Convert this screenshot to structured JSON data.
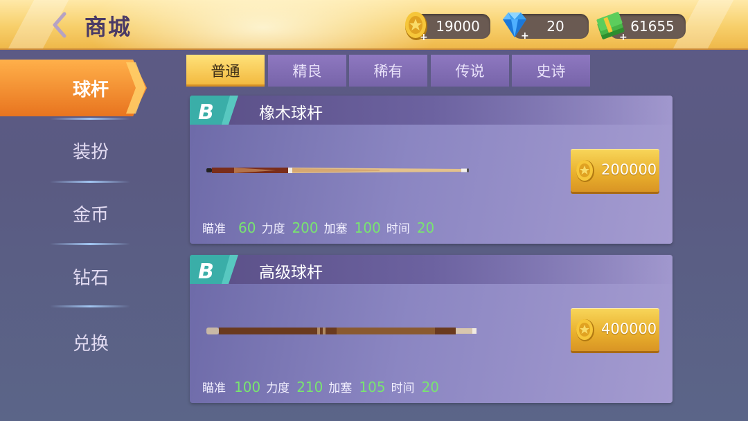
{
  "header": {
    "title": "商城"
  },
  "currencies": {
    "coins": "19000",
    "diamonds": "20",
    "cash": "61655"
  },
  "sidebar": {
    "items": [
      {
        "label": "球杆",
        "active": true
      },
      {
        "label": "装扮",
        "active": false
      },
      {
        "label": "金币",
        "active": false
      },
      {
        "label": "钻石",
        "active": false
      },
      {
        "label": "兑换",
        "active": false
      }
    ]
  },
  "tabs": [
    {
      "label": "普通",
      "active": true
    },
    {
      "label": "精良",
      "active": false
    },
    {
      "label": "稀有",
      "active": false
    },
    {
      "label": "传说",
      "active": false
    },
    {
      "label": "史诗",
      "active": false
    }
  ],
  "items": [
    {
      "tier": "B",
      "name": "橡木球杆",
      "price": "200000",
      "stats": {
        "aim_label": "瞄准",
        "aim": "60",
        "power_label": "力度",
        "power": "200",
        "spin_label": "加塞",
        "spin": "100",
        "time_label": "时间",
        "time": "20"
      }
    },
    {
      "tier": "B",
      "name": "高级球杆",
      "price": "400000",
      "stats": {
        "aim_label": "瞄准",
        "aim": "100",
        "power_label": "力度",
        "power": "210",
        "spin_label": "加塞",
        "spin": "105",
        "time_label": "时间",
        "time": "20"
      }
    }
  ],
  "colors": {
    "accent_gold": "#f2b73c",
    "stat_green": "#79e56f",
    "tab_purple": "#7764a9",
    "sidebar_active": "#f08a2c"
  }
}
